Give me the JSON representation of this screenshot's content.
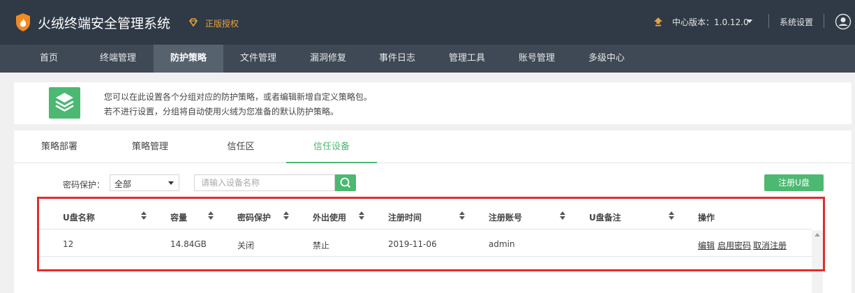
{
  "header": {
    "app_title": "火绒终端安全管理系统",
    "license": "正版授权",
    "version": "中心版本：1.0.12.0",
    "settings": "系统设置",
    "colors": {
      "bar": "#2f3a46",
      "license": "#e8a33c"
    }
  },
  "nav": {
    "items": [
      "首页",
      "终端管理",
      "防护策略",
      "文件管理",
      "漏洞修复",
      "事件日志",
      "管理工具",
      "账号管理",
      "多级中心"
    ],
    "active": "防护策略"
  },
  "info": {
    "line1": "您可以在此设置各个分组对应的防护策略，或者编辑新增自定义策略包。",
    "line2": "若不进行设置，分组将自动使用火绒为您准备的默认防护策略。",
    "icon": "layers-icon"
  },
  "tabs": {
    "items": [
      "策略部署",
      "策略管理",
      "信任区",
      "信任设备"
    ],
    "active": "信任设备"
  },
  "filter": {
    "label": "密码保护：",
    "selected": "全部",
    "search_placeholder": "请输入设备名称",
    "register_button": "注册U盘"
  },
  "table": {
    "columns": [
      "U盘名称",
      "容量",
      "密码保护",
      "外出使用",
      "注册时间",
      "注册账号",
      "U盘备注",
      "操作"
    ],
    "rows": [
      {
        "name": "12",
        "capacity": "14.84GB",
        "password": "关闭",
        "outside": "禁止",
        "date": "2019-11-06",
        "account": "admin",
        "note": "",
        "ops": [
          "编辑",
          "启用密码",
          "取消注册"
        ]
      }
    ]
  },
  "accent_color": "#4cb872",
  "highlight_color": "#e52b2b"
}
